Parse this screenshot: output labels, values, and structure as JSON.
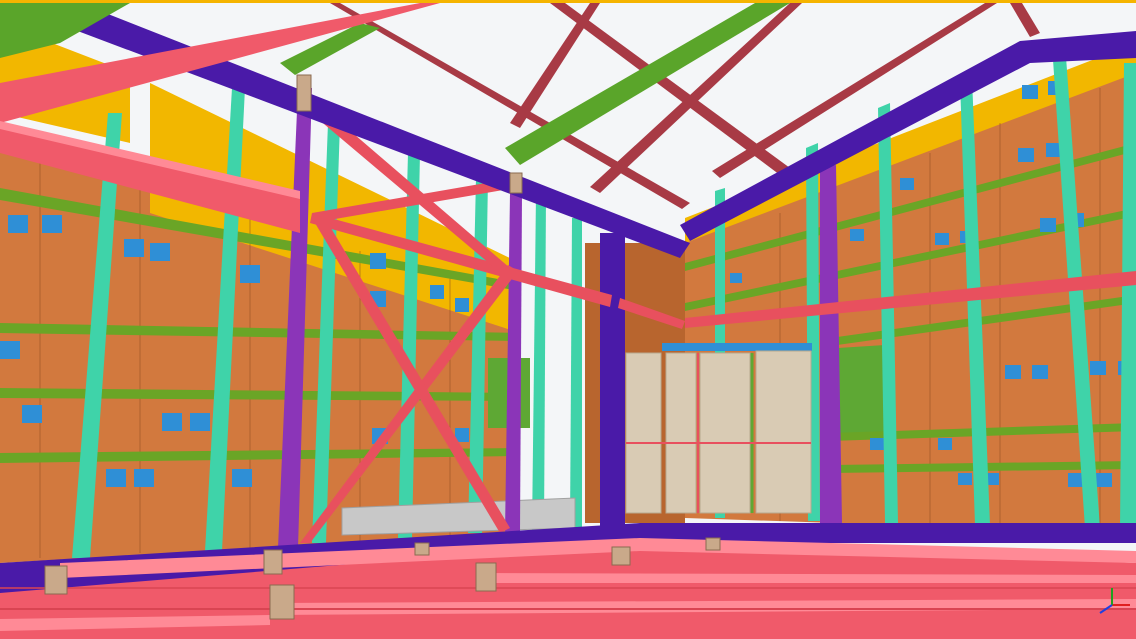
{
  "scene": {
    "colors": {
      "sky": "#f4f6f8",
      "frame_border": "#f5b400",
      "wall_panel": "#d2793e",
      "wall_panel_dark": "#b8652e",
      "insulation": "#f2b700",
      "girt": "#6aa526",
      "stud": "#3fd3a9",
      "column": "#8b35b8",
      "eave_beam": "#4a1aa8",
      "floor_beam": "#f05a6a",
      "floor_beam_top": "#ff8a96",
      "brace": "#e8505e",
      "roof_brace": "#a83a45",
      "ridge_beam": "#5aa52a",
      "clip": "#2f8fd6",
      "bolt_plate": "#c9a98a",
      "mesh": "#d9cbb4",
      "panel_green": "#5ea834",
      "duct": "#c8c8c8"
    }
  }
}
